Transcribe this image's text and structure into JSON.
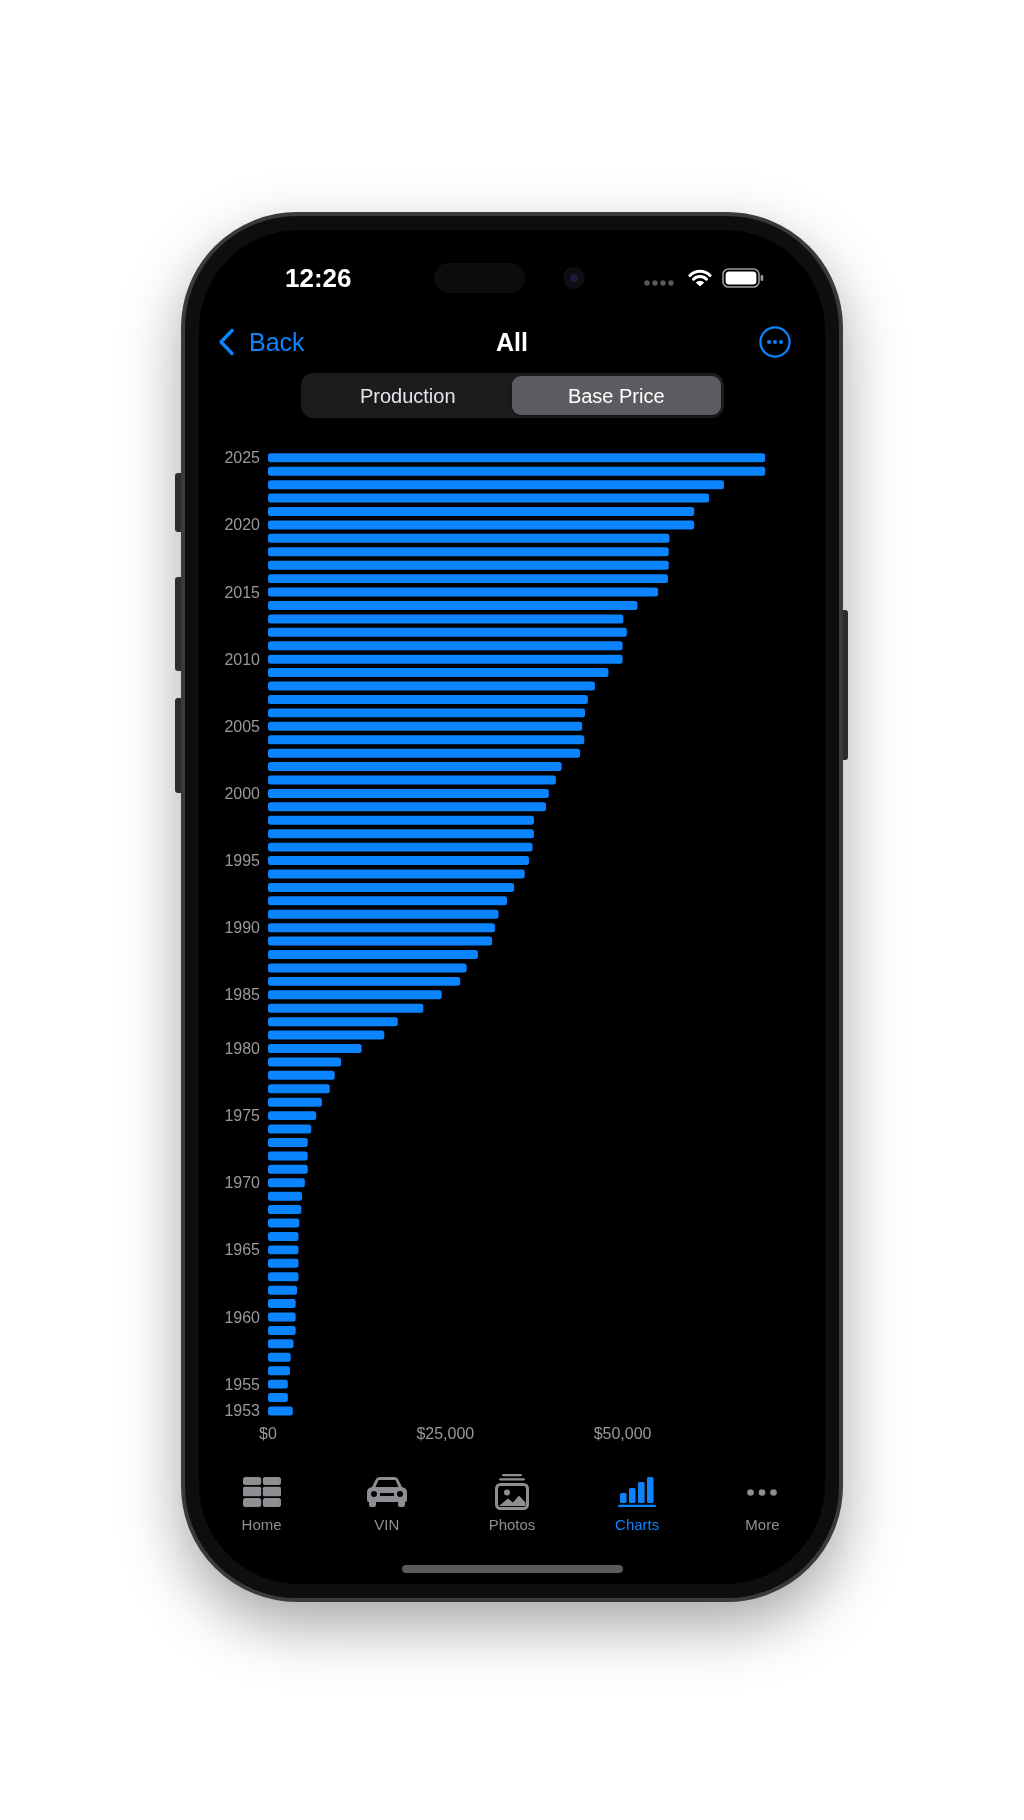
{
  "status_bar": {
    "time": "12:26"
  },
  "nav_bar": {
    "back": "Back",
    "title": "All"
  },
  "segments": [
    {
      "label": "Production",
      "selected": false
    },
    {
      "label": "Base Price",
      "selected": true
    }
  ],
  "chart": {
    "chart_data": {
      "type": "bar",
      "orientation": "horizontal",
      "x": [
        2025,
        2024,
        2023,
        2022,
        2021,
        2020,
        2019,
        2018,
        2017,
        2016,
        2015,
        2014,
        2013,
        2012,
        2011,
        2010,
        2009,
        2008,
        2007,
        2006,
        2005,
        2004,
        2003,
        2002,
        2001,
        2000,
        1999,
        1998,
        1997,
        1996,
        1995,
        1994,
        1993,
        1992,
        1991,
        1990,
        1989,
        1988,
        1987,
        1986,
        1985,
        1984,
        1982,
        1981,
        1980,
        1979,
        1978,
        1977,
        1976,
        1975,
        1974,
        1973,
        1972,
        1971,
        1970,
        1969,
        1968,
        1967,
        1966,
        1965,
        1964,
        1963,
        1962,
        1961,
        1960,
        1959,
        1958,
        1957,
        1956,
        1955,
        1954,
        1953
      ],
      "values": [
        70100,
        70100,
        64300,
        62200,
        60100,
        60100,
        56600,
        56500,
        56500,
        56400,
        55000,
        52100,
        50100,
        50600,
        50000,
        50000,
        48000,
        46100,
        45100,
        44700,
        44300,
        44600,
        44000,
        41400,
        40600,
        39600,
        39200,
        37500,
        37500,
        37300,
        36800,
        36200,
        34700,
        33700,
        32500,
        32000,
        31600,
        29600,
        28000,
        27100,
        24500,
        21900,
        18300,
        16400,
        13200,
        10300,
        9400,
        8700,
        7600,
        6800,
        6100,
        5600,
        5600,
        5600,
        5200,
        4800,
        4700,
        4400,
        4300,
        4300,
        4300,
        4300,
        4100,
        3900,
        3900,
        3900,
        3600,
        3200,
        3100,
        2800,
        2800,
        3500
      ],
      "xlim": [
        0,
        70100
      ],
      "ylim": [
        1953,
        2025
      ],
      "xticks": [
        {
          "value": 0,
          "label": "$0"
        },
        {
          "value": 25000,
          "label": "$25,000"
        },
        {
          "value": 50000,
          "label": "$50,000"
        }
      ],
      "yticks": [
        2025,
        2020,
        2015,
        2010,
        2005,
        2000,
        1995,
        1990,
        1985,
        1980,
        1975,
        1970,
        1965,
        1960,
        1955,
        1953
      ]
    }
  },
  "tab_bar": [
    {
      "label": "Home",
      "selected": false
    },
    {
      "label": "VIN",
      "selected": false
    },
    {
      "label": "Photos",
      "selected": false
    },
    {
      "label": "Charts",
      "selected": true
    },
    {
      "label": "More",
      "selected": false
    }
  ]
}
